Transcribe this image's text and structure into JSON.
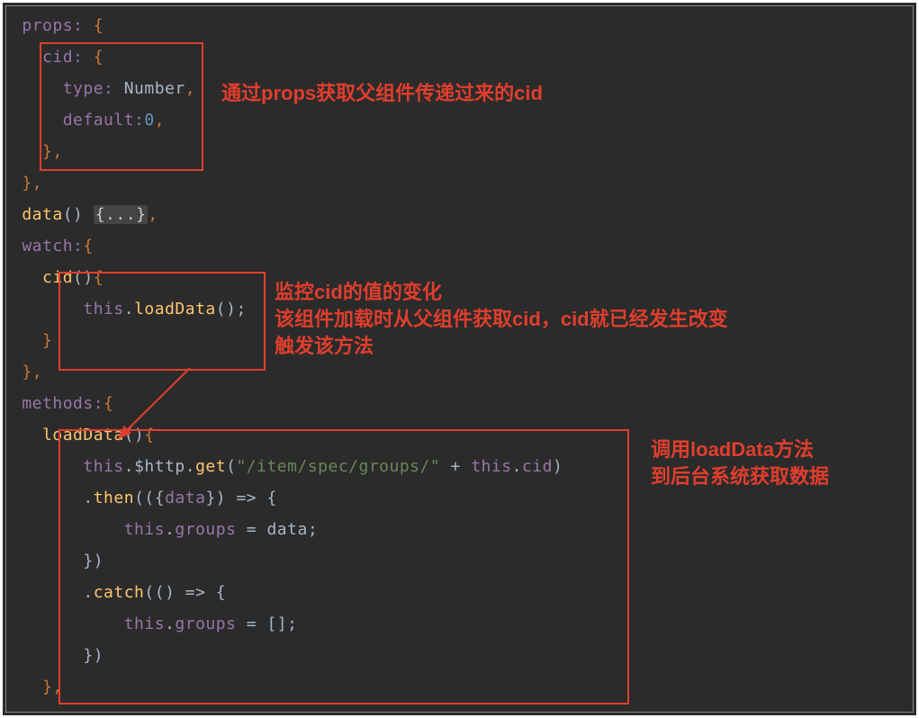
{
  "code_lines": [
    [
      [
        " ",
        "plain"
      ],
      [
        "props: ",
        "prop"
      ],
      [
        "{",
        "brace"
      ]
    ],
    [
      [
        "   ",
        "plain"
      ],
      [
        "cid: ",
        "prop"
      ],
      [
        "{",
        "brace"
      ]
    ],
    [
      [
        "     ",
        "plain"
      ],
      [
        "type: ",
        "prop"
      ],
      [
        "Number",
        "ident"
      ],
      [
        ",",
        "comma"
      ]
    ],
    [
      [
        "     ",
        "plain"
      ],
      [
        "default:",
        "prop"
      ],
      [
        "0",
        "num"
      ],
      [
        ",",
        "comma"
      ]
    ],
    [
      [
        "   ",
        "plain"
      ],
      [
        "}",
        "brace"
      ],
      [
        ",",
        "comma"
      ]
    ],
    [
      [
        " ",
        "plain"
      ],
      [
        "}",
        "brace"
      ],
      [
        ",",
        "comma"
      ]
    ],
    [
      [
        " ",
        "plain"
      ],
      [
        "data",
        "func"
      ],
      [
        "() ",
        "par"
      ],
      [
        "{...}",
        "folded"
      ],
      [
        ",",
        "comma"
      ]
    ],
    [
      [
        " ",
        "plain"
      ],
      [
        "watch:",
        "prop"
      ],
      [
        "{",
        "brace"
      ]
    ],
    [
      [
        "   ",
        "plain"
      ],
      [
        "cid",
        "func"
      ],
      [
        "()",
        "par"
      ],
      [
        "{",
        "brace"
      ]
    ],
    [
      [
        "       ",
        "plain"
      ],
      [
        "this",
        "this"
      ],
      [
        ".",
        "plain"
      ],
      [
        "loadData",
        "func"
      ],
      [
        "();",
        "par"
      ]
    ],
    [
      [
        "   ",
        "plain"
      ],
      [
        "}",
        "brace"
      ]
    ],
    [
      [
        " ",
        "plain"
      ],
      [
        "}",
        "brace"
      ],
      [
        ",",
        "comma"
      ]
    ],
    [
      [
        " ",
        "plain"
      ],
      [
        "methods:",
        "prop"
      ],
      [
        "{",
        "brace"
      ]
    ],
    [
      [
        "   ",
        "plain"
      ],
      [
        "loadData",
        "func"
      ],
      [
        "()",
        "par"
      ],
      [
        "{",
        "brace"
      ]
    ],
    [
      [
        "       ",
        "plain"
      ],
      [
        "this",
        "this"
      ],
      [
        ".",
        "plain"
      ],
      [
        "$http.",
        "plain"
      ],
      [
        "get",
        "func"
      ],
      [
        "(",
        "par"
      ],
      [
        "\"/item/spec/groups/\"",
        "str"
      ],
      [
        " + ",
        "plain"
      ],
      [
        "this",
        "this"
      ],
      [
        ".",
        "plain"
      ],
      [
        "cid",
        "prop"
      ],
      [
        ")",
        "par"
      ]
    ],
    [
      [
        "       ",
        "plain"
      ],
      [
        ".",
        "plain"
      ],
      [
        "then",
        "func"
      ],
      [
        "(({",
        "par"
      ],
      [
        "data",
        "prop"
      ],
      [
        "}) => {",
        "par"
      ]
    ],
    [
      [
        "           ",
        "plain"
      ],
      [
        "this",
        "this"
      ],
      [
        ".",
        "plain"
      ],
      [
        "groups",
        "prop"
      ],
      [
        " = ",
        "plain"
      ],
      [
        "data",
        "ident"
      ],
      [
        ";",
        "plain"
      ]
    ],
    [
      [
        "       ",
        "plain"
      ],
      [
        "})",
        "par"
      ]
    ],
    [
      [
        "       ",
        "plain"
      ],
      [
        ".",
        "plain"
      ],
      [
        "catch",
        "func"
      ],
      [
        "(() => {",
        "par"
      ]
    ],
    [
      [
        "           ",
        "plain"
      ],
      [
        "this",
        "this"
      ],
      [
        ".",
        "plain"
      ],
      [
        "groups",
        "prop"
      ],
      [
        " = [];",
        "plain"
      ]
    ],
    [
      [
        "       ",
        "plain"
      ],
      [
        "})",
        "par"
      ]
    ],
    [
      [
        "   ",
        "plain"
      ],
      [
        "}",
        "brace"
      ],
      [
        ",",
        "comma"
      ]
    ]
  ],
  "annotations": {
    "props": "通过props获取父组件传递过来的cid",
    "watch_l1": "监控cid的值的变化",
    "watch_l2": "该组件加载时从父组件获取cid，cid就已经发生改变",
    "watch_l3": "触发该方法",
    "load_l1": "调用loadData方法",
    "load_l2": "到后台系统获取数据"
  }
}
